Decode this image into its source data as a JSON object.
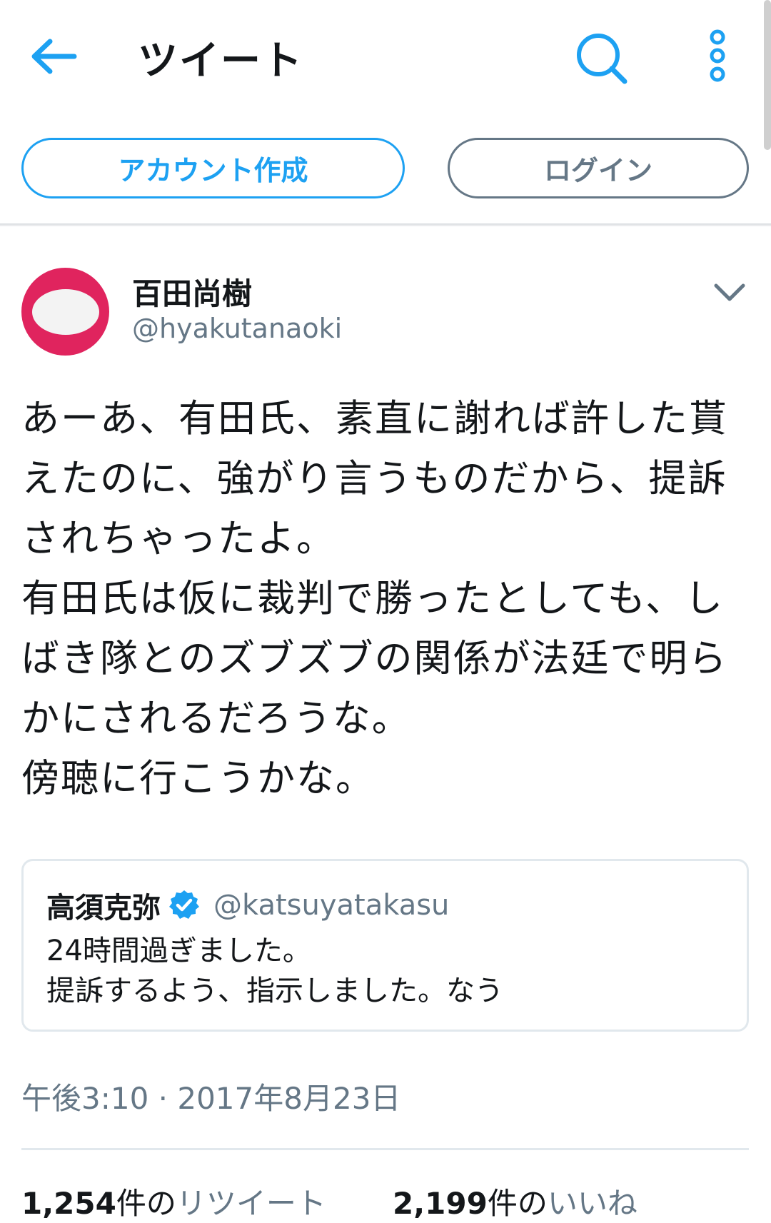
{
  "header": {
    "title": "ツイート",
    "back_icon": "arrow-left-icon",
    "search_icon": "search-icon",
    "more_icon": "more-vertical-icon",
    "accent_color": "#1da1f2"
  },
  "auth": {
    "signup_label": "アカウント作成",
    "login_label": "ログイン"
  },
  "tweet": {
    "author_name": "百田尚樹",
    "author_handle": "@hyakutanaoki",
    "avatar_color": "#e0245e",
    "text_lines": [
      "あーあ、有田氏、素直に謝れば許した貰",
      "えたのに、強がり言うものだから、提訴",
      "されちゃったよ。",
      "有田氏は仮に裁判で勝ったとしても、し",
      "ばき隊とのズブズブの関係が法廷で明ら",
      "かにされるだろうな。",
      "傍聴に行こうかな。"
    ],
    "quoted": {
      "name": "高須克弥",
      "verified": true,
      "handle": "@katsuyatakasu",
      "text_lines": [
        "24時間過ぎました。",
        "提訴するよう、指示しました。なう"
      ]
    },
    "timestamp": "午後3:10 · 2017年8月23日",
    "retweets": {
      "count": "1,254",
      "unit": "件の",
      "label": "リツイート"
    },
    "likes": {
      "count": "2,199",
      "unit": "件の",
      "label": "いいね"
    }
  }
}
